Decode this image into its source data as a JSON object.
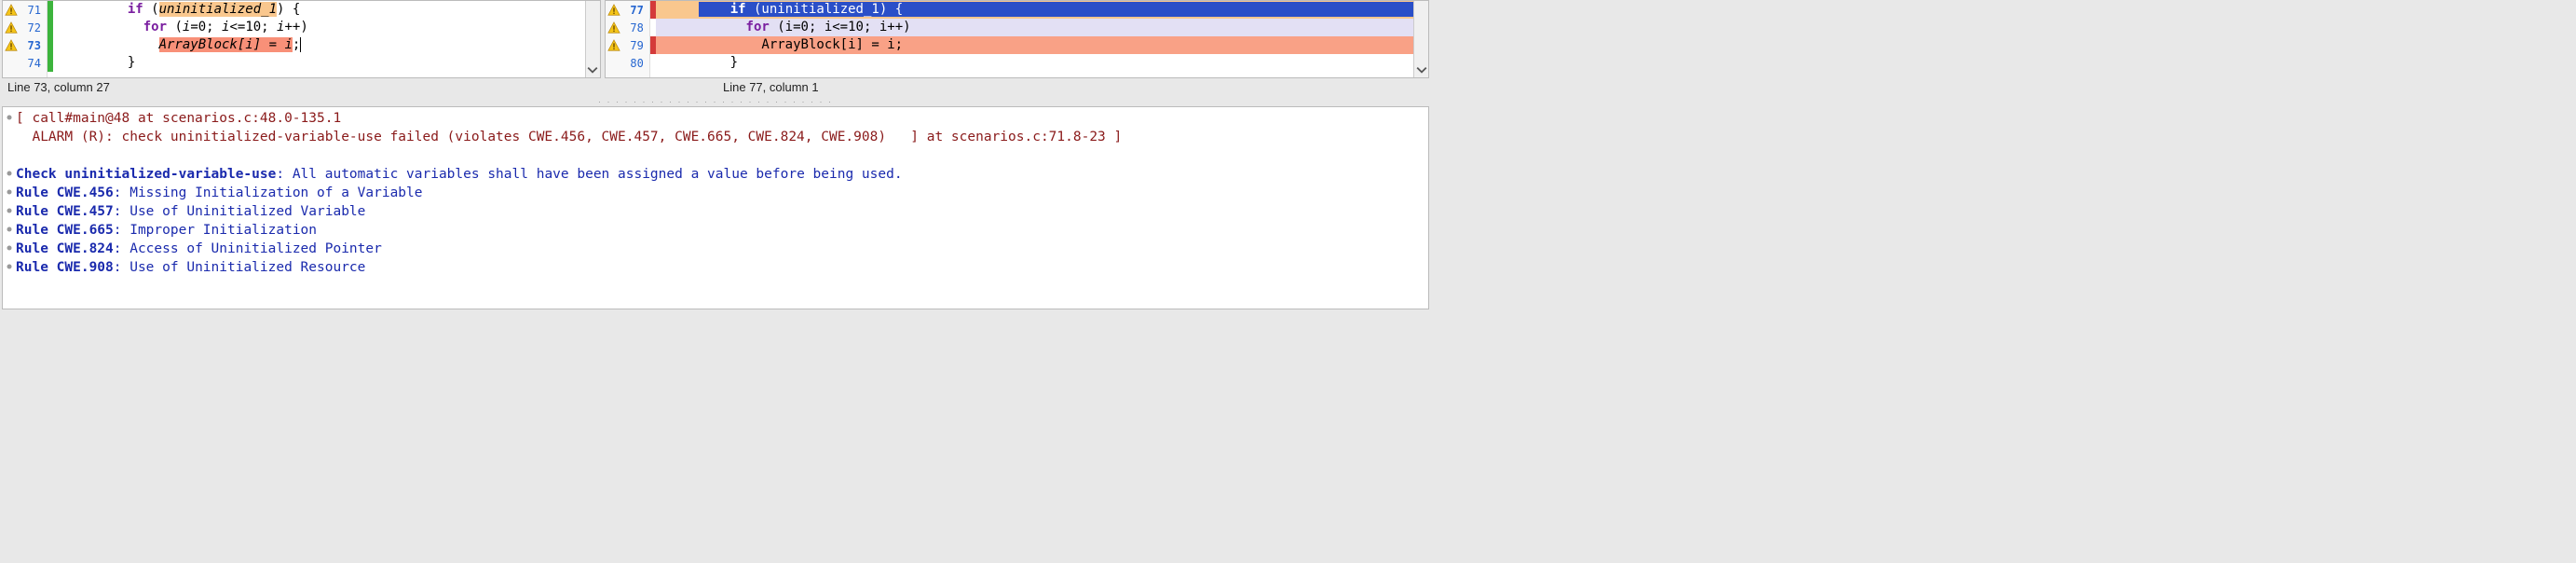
{
  "left_pane": {
    "lines": [
      {
        "num": "71",
        "warn": true,
        "bar": "cb-green",
        "indent": "         ",
        "tokens": [
          {
            "t": "if",
            "cls": "kw"
          },
          {
            "t": " ("
          },
          {
            "t": "uninitialized_1",
            "cls": "hl-orange varname"
          },
          {
            "t": ") {"
          }
        ]
      },
      {
        "num": "72",
        "warn": true,
        "bar": "cb-green",
        "indent": "           ",
        "tokens": [
          {
            "t": "for",
            "cls": "kw"
          },
          {
            "t": " ("
          },
          {
            "t": "i",
            "cls": "varname"
          },
          {
            "t": "=0; "
          },
          {
            "t": "i",
            "cls": "varname"
          },
          {
            "t": "<=10; "
          },
          {
            "t": "i",
            "cls": "varname"
          },
          {
            "t": "++)"
          }
        ]
      },
      {
        "num": "73",
        "warn": true,
        "bar": "cb-green",
        "bold": true,
        "indent": "             ",
        "tokens": [
          {
            "t": "ArrayBlock[i] = i",
            "cls": "hl-salmon varname"
          },
          {
            "t": ";"
          },
          {
            "t": "",
            "cls": "cursor"
          }
        ]
      },
      {
        "num": "74",
        "warn": false,
        "bar": "cb-green",
        "indent": "         ",
        "tokens": [
          {
            "t": "}"
          }
        ]
      }
    ],
    "status": "Line 73, column 27"
  },
  "right_pane": {
    "lines": [
      {
        "num": "77",
        "warn": true,
        "bar": "cb-red",
        "bold": true,
        "row_cls": "hl-orange",
        "pre_indent": "     ",
        "sel_indent": "    ",
        "tokens": [
          {
            "t": "if",
            "cls": "kw"
          },
          {
            "t": " (uninitialized_1) {"
          }
        ],
        "selected": true
      },
      {
        "num": "78",
        "warn": true,
        "bar": "",
        "row_cls": "hl-lavender",
        "indent": "           ",
        "tokens": [
          {
            "t": "for",
            "cls": "kw"
          },
          {
            "t": " (i=0; i<=10; i++)"
          }
        ]
      },
      {
        "num": "79",
        "warn": true,
        "bar": "cb-red",
        "row_cls": "hl-coral-row",
        "indent": "             ",
        "tokens": [
          {
            "t": "ArrayBlock[i] = i;"
          }
        ]
      },
      {
        "num": "80",
        "warn": false,
        "bar": "",
        "indent": "         ",
        "tokens": [
          {
            "t": "}"
          }
        ]
      }
    ],
    "status": "Line 77, column 1"
  },
  "bottom": {
    "lines": [
      {
        "cls": "dark-red",
        "tick": true,
        "text": "[ call#main@48 at scenarios.c:48.0-135.1"
      },
      {
        "cls": "dark-red",
        "text": "  ALARM (R): check uninitialized-variable-use failed (violates CWE.456, CWE.457, CWE.665, CWE.824, CWE.908)   ] at scenarios.c:71.8-23 ]"
      },
      {
        "text": " "
      },
      {
        "cls": "dark-blue",
        "tick": true,
        "parts": [
          {
            "t": "Check uninitialized-variable-use",
            "b": true
          },
          {
            "t": ": All automatic variables shall have been assigned a value before being used."
          }
        ]
      },
      {
        "cls": "dark-blue",
        "tick": true,
        "parts": [
          {
            "t": "Rule CWE.456",
            "b": true
          },
          {
            "t": ": Missing Initialization of a Variable"
          }
        ]
      },
      {
        "cls": "dark-blue",
        "tick": true,
        "parts": [
          {
            "t": "Rule CWE.457",
            "b": true
          },
          {
            "t": ": Use of Uninitialized Variable"
          }
        ]
      },
      {
        "cls": "dark-blue",
        "tick": true,
        "parts": [
          {
            "t": "Rule CWE.665",
            "b": true
          },
          {
            "t": ": Improper Initialization"
          }
        ]
      },
      {
        "cls": "dark-blue",
        "tick": true,
        "parts": [
          {
            "t": "Rule CWE.824",
            "b": true
          },
          {
            "t": ": Access of Uninitialized Pointer"
          }
        ]
      },
      {
        "cls": "dark-blue",
        "tick": true,
        "parts": [
          {
            "t": "Rule CWE.908",
            "b": true
          },
          {
            "t": ": Use of Uninitialized Resource"
          }
        ]
      }
    ]
  }
}
